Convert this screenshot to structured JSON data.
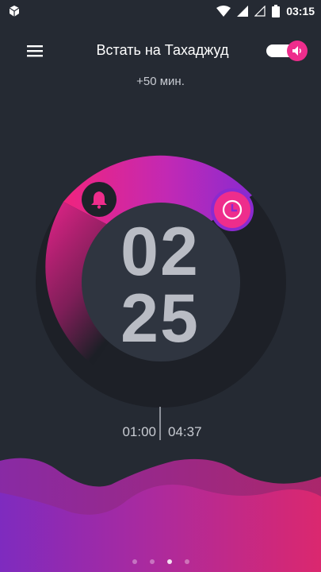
{
  "status_bar": {
    "time": "03:15",
    "left_icon": "app-box-icon",
    "icons": [
      "wifi-icon",
      "signal-icon",
      "signal-empty-icon",
      "battery-icon"
    ]
  },
  "header": {
    "menu_icon": "hamburger-menu-icon",
    "title": "Встать на Тахаджуд",
    "toggle_on": true,
    "toggle_icon": "speaker-icon"
  },
  "subtitle": "+50 мин.",
  "clock": {
    "hours": "02",
    "minutes": "25",
    "start_icon": "bell-icon",
    "end_icon": "clock-icon"
  },
  "times": {
    "start": "01:00",
    "end": "04:37"
  },
  "pager": {
    "count": 4,
    "active_index": 2
  },
  "colors": {
    "background": "#252a33",
    "accent_pink": "#ee2d8c",
    "accent_purple": "#8a2ad0",
    "clock_text": "#b9bcc4"
  }
}
